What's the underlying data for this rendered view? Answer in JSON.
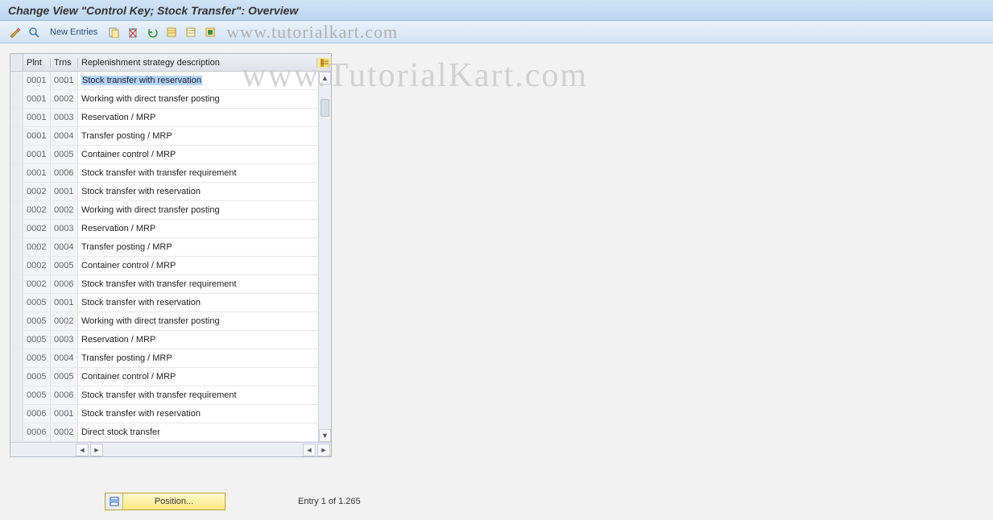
{
  "title": "Change View \"Control Key; Stock Transfer\": Overview",
  "toolbar": {
    "new_entries": "New Entries"
  },
  "watermark_toolbar": "www.tutorialkart.com",
  "watermark_main": "www.TutorialKart.com",
  "columns": {
    "plnt": "Plnt",
    "trns": "Trns",
    "desc": "Replenishment strategy description"
  },
  "rows": [
    {
      "plnt": "0001",
      "trns": "0001",
      "desc": "Stock transfer with reservation",
      "selected": true
    },
    {
      "plnt": "0001",
      "trns": "0002",
      "desc": "Working with direct transfer posting"
    },
    {
      "plnt": "0001",
      "trns": "0003",
      "desc": "Reservation / MRP"
    },
    {
      "plnt": "0001",
      "trns": "0004",
      "desc": "Transfer posting / MRP"
    },
    {
      "plnt": "0001",
      "trns": "0005",
      "desc": "Container control / MRP"
    },
    {
      "plnt": "0001",
      "trns": "0006",
      "desc": "Stock transfer with transfer requirement"
    },
    {
      "plnt": "0002",
      "trns": "0001",
      "desc": "Stock transfer with reservation"
    },
    {
      "plnt": "0002",
      "trns": "0002",
      "desc": "Working with direct transfer posting"
    },
    {
      "plnt": "0002",
      "trns": "0003",
      "desc": "Reservation / MRP"
    },
    {
      "plnt": "0002",
      "trns": "0004",
      "desc": "Transfer posting / MRP"
    },
    {
      "plnt": "0002",
      "trns": "0005",
      "desc": "Container control / MRP"
    },
    {
      "plnt": "0002",
      "trns": "0006",
      "desc": "Stock transfer with transfer requirement"
    },
    {
      "plnt": "0005",
      "trns": "0001",
      "desc": "Stock transfer with reservation"
    },
    {
      "plnt": "0005",
      "trns": "0002",
      "desc": "Working with direct transfer posting"
    },
    {
      "plnt": "0005",
      "trns": "0003",
      "desc": "Reservation / MRP"
    },
    {
      "plnt": "0005",
      "trns": "0004",
      "desc": "Transfer posting / MRP"
    },
    {
      "plnt": "0005",
      "trns": "0005",
      "desc": "Container control / MRP"
    },
    {
      "plnt": "0005",
      "trns": "0006",
      "desc": "Stock transfer with transfer requirement"
    },
    {
      "plnt": "0006",
      "trns": "0001",
      "desc": "Stock transfer with reservation"
    },
    {
      "plnt": "0006",
      "trns": "0002",
      "desc": "Direct stock transfer"
    }
  ],
  "footer": {
    "position_btn": "Position...",
    "entry_info": "Entry 1 of 1.265"
  }
}
